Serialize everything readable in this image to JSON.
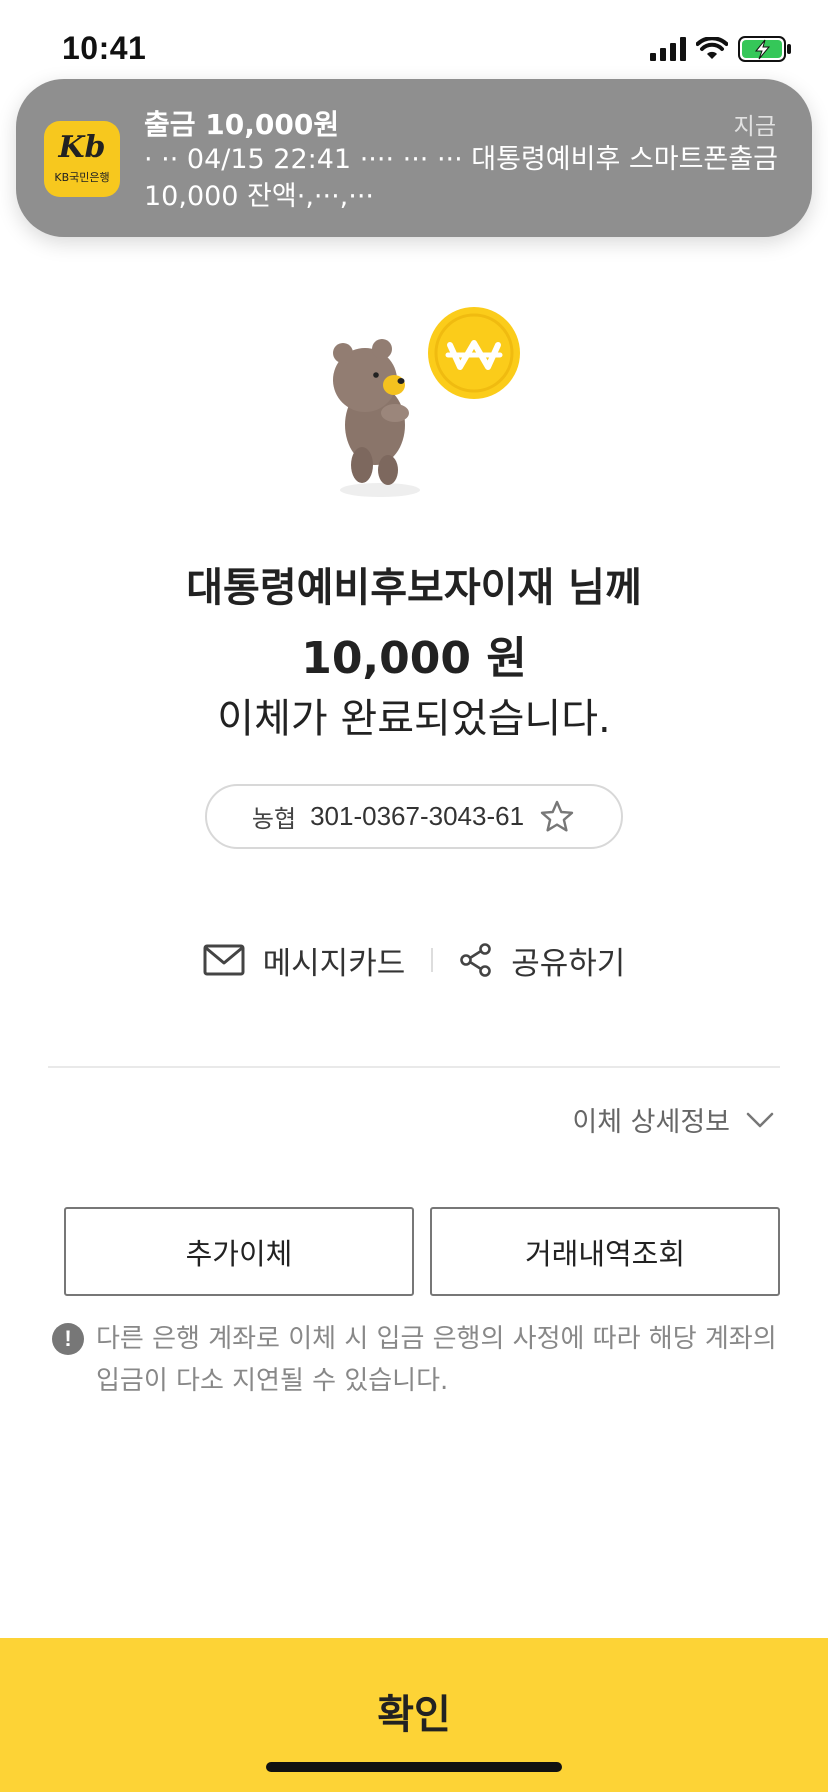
{
  "status_bar": {
    "time": "10:41"
  },
  "notification": {
    "app_name": "KB국민은행",
    "app_mark": "Kb",
    "title": "출금 10,000원",
    "time": "지금",
    "body": "·  ·· 04/15 22:41  ···· ··· ··· 대통령예비후 스마트폰출금 10,000 잔액·,···,···",
    "icon_color": "#f7c81e"
  },
  "illustration": {
    "coin_symbol": "W",
    "coin_color": "#fbcc1a"
  },
  "result": {
    "recipient": "대통령예비후보자이재 님께",
    "amount": "10,000 원",
    "message": "이체가 완료되었습니다."
  },
  "account": {
    "bank": "농협",
    "number": "301-0367-3043-61",
    "favorite_icon": "star-outline-icon"
  },
  "actions": {
    "message_card": "메시지카드",
    "share": "공유하기"
  },
  "detail_toggle": {
    "label": "이체 상세정보"
  },
  "buttons": {
    "additional_transfer": "추가이체",
    "transaction_history": "거래내역조회"
  },
  "notice": {
    "icon": "!",
    "text": "다른 은행 계좌로 이체 시 입금 은행의 사정에 따라 해당 계좌의 입금이 다소 지연될 수 있습니다."
  },
  "confirm": {
    "label": "확인",
    "color": "#fdd336"
  }
}
